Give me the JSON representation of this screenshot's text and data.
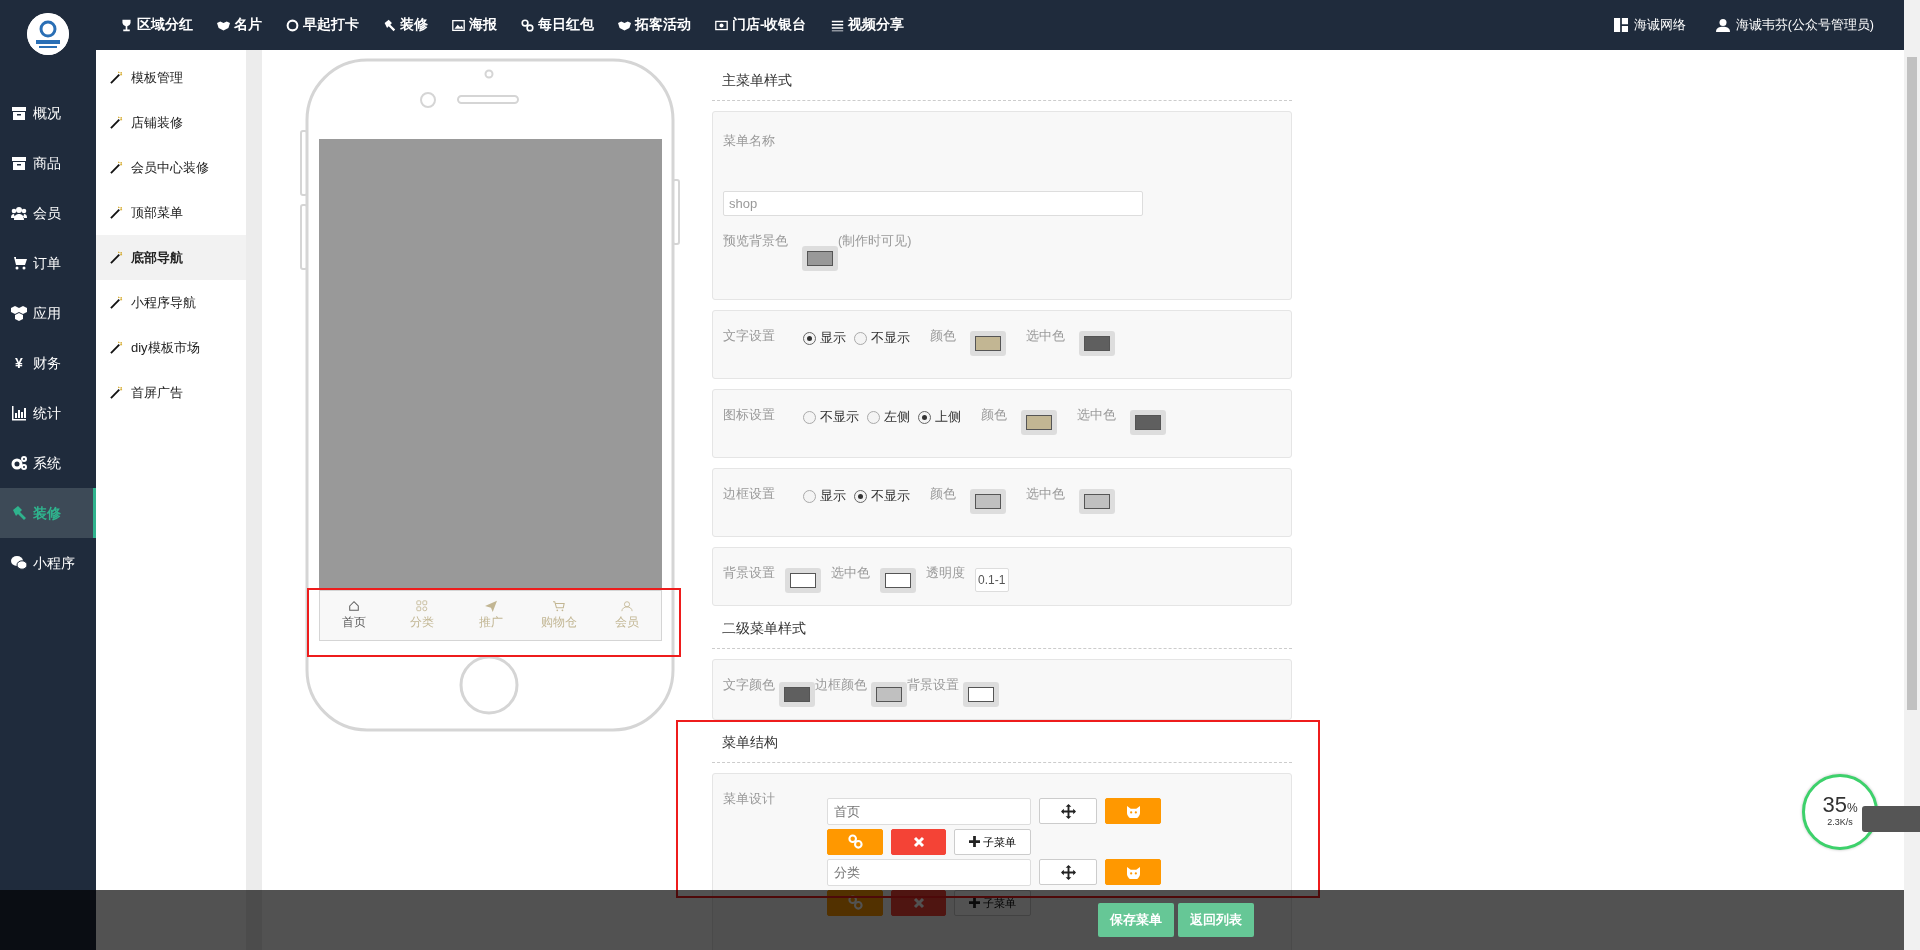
{
  "top_nav": {
    "items": [
      {
        "label": "区域分红"
      },
      {
        "label": "名片"
      },
      {
        "label": "早起打卡"
      },
      {
        "label": "装修"
      },
      {
        "label": "海报"
      },
      {
        "label": "每日红包"
      },
      {
        "label": "拓客活动"
      },
      {
        "label": "门店-收银台"
      },
      {
        "label": "视频分享"
      }
    ],
    "right": [
      {
        "label": "海诚网络"
      },
      {
        "label": "海诚韦芬(公众号管理员)"
      }
    ]
  },
  "sidebar": {
    "items": [
      {
        "label": "概况",
        "selected": false
      },
      {
        "label": "商品",
        "selected": false
      },
      {
        "label": "会员",
        "selected": false
      },
      {
        "label": "订单",
        "selected": false
      },
      {
        "label": "应用",
        "selected": false
      },
      {
        "label": "财务",
        "glyph": "¥",
        "selected": false
      },
      {
        "label": "统计",
        "selected": false
      },
      {
        "label": "系统",
        "selected": false
      },
      {
        "label": "装修",
        "selected": true
      },
      {
        "label": "小程序",
        "selected": false
      }
    ]
  },
  "subnav": {
    "items": [
      {
        "label": "模板管理",
        "selected": false
      },
      {
        "label": "店铺装修",
        "selected": false
      },
      {
        "label": "会员中心装修",
        "selected": false
      },
      {
        "label": "顶部菜单",
        "selected": false
      },
      {
        "label": "底部导航",
        "selected": true
      },
      {
        "label": "小程序导航",
        "selected": false
      },
      {
        "label": "diy模板市场",
        "selected": false
      },
      {
        "label": "首屏广告",
        "selected": false
      }
    ]
  },
  "phone": {
    "highlighted": true,
    "tabs": [
      {
        "label": "首页",
        "selected": true
      },
      {
        "label": "分类",
        "selected": false
      },
      {
        "label": "推广",
        "selected": false
      },
      {
        "label": "购物仓",
        "selected": false
      },
      {
        "label": "会员",
        "selected": false
      }
    ]
  },
  "main_style": {
    "title": "主菜单样式",
    "name_label": "菜单名称",
    "name_value": "shop",
    "preview": [
      {
        "label": "预览背景色",
        "color": "#999999",
        "note": "(制作时可见)"
      }
    ],
    "rows": [
      {
        "label": "文字设置",
        "options": [
          {
            "label": "显示",
            "selected": true
          },
          {
            "label": "不显示",
            "selected": false
          }
        ],
        "swatches": [
          {
            "label": "颜色",
            "color": "#c2b693"
          },
          {
            "label": "选中色",
            "color": "#5f5f5f"
          }
        ]
      },
      {
        "label": "图标设置",
        "options": [
          {
            "label": "不显示",
            "selected": false
          },
          {
            "label": "左侧",
            "selected": false
          },
          {
            "label": "上侧",
            "selected": true
          }
        ],
        "swatches": [
          {
            "label": "颜色",
            "color": "#c2b693"
          },
          {
            "label": "选中色",
            "color": "#5f5f5f"
          }
        ]
      },
      {
        "label": "边框设置",
        "options": [
          {
            "label": "显示",
            "selected": false
          },
          {
            "label": "不显示",
            "selected": true
          }
        ],
        "swatches": [
          {
            "label": "颜色",
            "color": "#c0c0c0"
          },
          {
            "label": "选中色",
            "color": "#c0c0c0"
          }
        ]
      }
    ],
    "background": {
      "swatches": [
        {
          "label": "背景设置",
          "color": "#ffffff"
        },
        {
          "label": "选中色",
          "color": "#ffffff"
        }
      ],
      "opacity_label": "透明度",
      "opacity_value": "0.1-1"
    }
  },
  "sub_style": {
    "title": "二级菜单样式",
    "swatches": [
      {
        "label": "文字颜色",
        "color": "#5f5f5f"
      },
      {
        "label": "边框颜色",
        "color": "#c0c0c0"
      },
      {
        "label": "背景设置",
        "color": "#ffffff"
      }
    ]
  },
  "structure": {
    "title": "菜单结构",
    "highlighted": true,
    "label": "菜单设计",
    "items": [
      {
        "placeholder": "首页",
        "sub_label": "子菜单"
      },
      {
        "placeholder": "分类",
        "sub_label": "子菜单"
      }
    ]
  },
  "footer": {
    "buttons": [
      "保存菜单",
      "返回列表"
    ]
  },
  "net_widget": {
    "percent": "35",
    "unit": "%",
    "speed": "2.3K/s"
  }
}
